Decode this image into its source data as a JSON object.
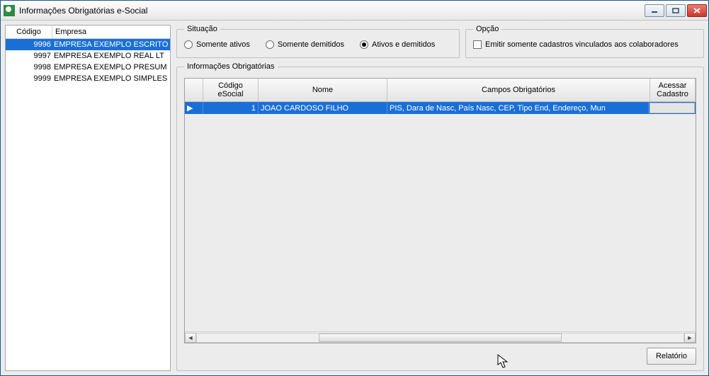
{
  "window": {
    "title": "Informações Obrigatórias e-Social"
  },
  "companies": {
    "headers": {
      "codigo": "Código",
      "empresa": "Empresa"
    },
    "rows": [
      {
        "codigo": "9996",
        "empresa": "EMPRESA EXEMPLO ESCRITÓ",
        "selected": true
      },
      {
        "codigo": "9997",
        "empresa": "EMPRESA EXEMPLO REAL LT",
        "selected": false
      },
      {
        "codigo": "9998",
        "empresa": "EMPRESA EXEMPLO PRESUM",
        "selected": false
      },
      {
        "codigo": "9999",
        "empresa": "EMPRESA EXEMPLO SIMPLES",
        "selected": false
      }
    ]
  },
  "situacao": {
    "legend": "Situação",
    "options": {
      "ativos": "Somente ativos",
      "demitidos": "Somente demitidos",
      "ambos": "Ativos e demitidos"
    },
    "selected": "ambos"
  },
  "opcao": {
    "legend": "Opção",
    "checkbox_label": "Emitir somente cadastros vinculados aos colaboradores",
    "checked": false
  },
  "info": {
    "legend": "Informações Obrigatórias",
    "headers": {
      "codigo": "Código eSocial",
      "nome": "Nome",
      "campos": "Campos Obrigatórios",
      "acessar": "Acessar Cadastro"
    },
    "rows": [
      {
        "codigo": "1",
        "nome": "JOAO CARDOSO FILHO",
        "campos": "PIS, Dara de Nasc, País Nasc, CEP, Tipo End, Endereço, Mun"
      }
    ]
  },
  "buttons": {
    "relatorio": "Relatório"
  }
}
